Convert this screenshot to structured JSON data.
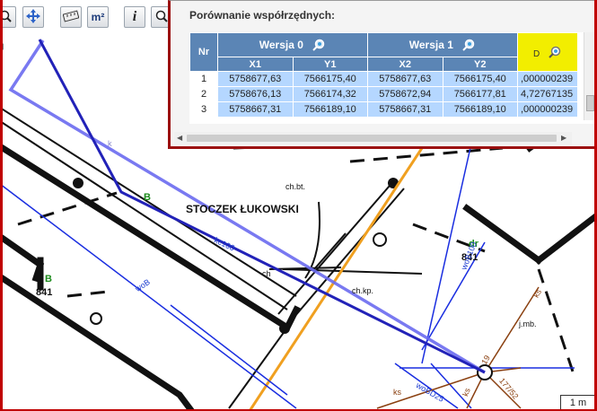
{
  "panel": {
    "title": "Porównanie współrzędnych:",
    "version0_label": "Wersja 0",
    "version1_label": "Wersja 1",
    "d_label": "D",
    "nr_label": "Nr",
    "subheaders": [
      "X1",
      "Y1",
      "X2",
      "Y2"
    ],
    "rows": [
      {
        "nr": "1",
        "x1": "5758677,63",
        "y1": "7566175,40",
        "x2": "5758677,63",
        "y2": "7566175,40",
        "d": ",000000239"
      },
      {
        "nr": "2",
        "x1": "5758676,13",
        "y1": "7566174,32",
        "x2": "5758672,94",
        "y2": "7566177,81",
        "d": "4,72767135"
      },
      {
        "nr": "3",
        "x1": "5758667,31",
        "y1": "7566189,10",
        "x2": "5758667,31",
        "y2": "7566189,10",
        "d": ",000000239"
      }
    ],
    "colors": {
      "header": "#5b85b5",
      "highlight_col": "#f2ee00",
      "selected": "#b5d7ff"
    }
  },
  "toolbar": {
    "icons": [
      "zoom-window-icon",
      "pan-icon",
      "measure-distance-icon",
      "measure-area-icon",
      "info-icon",
      "search-icon"
    ],
    "area_label": "m²",
    "info_label": "i"
  },
  "map": {
    "labels": {
      "stoczek": "STOCZEK ŁUKOWSKI",
      "b_mid": "B",
      "b_left": "B",
      "num_left": "841",
      "dr": "dr",
      "num_right": "841",
      "ch_bt": "ch.bt.",
      "ch_kp": "ch.kp.",
      "ch_small": "ch",
      "j_mb": "j.mb.",
      "wob_left": "woB",
      "wob_right": "woB100",
      "wob_d25": "woBD25",
      "ks_left": "ks",
      "ks_right": "ks",
      "ks_bottom": "ks",
      "tag_19": "19",
      "tag_177": "177/52",
      "kc": "kc100",
      "k_small": "k"
    },
    "scale_label": "1 m"
  }
}
